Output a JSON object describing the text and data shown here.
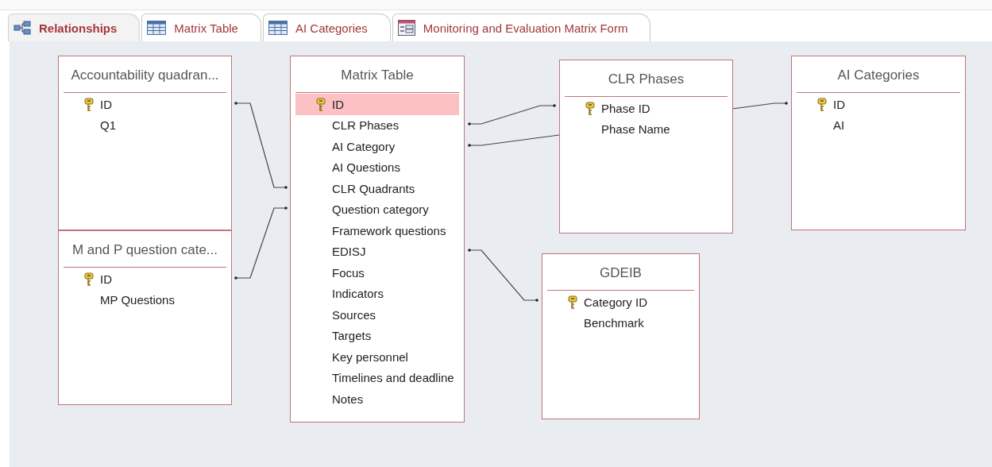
{
  "tabs": [
    {
      "label": "Relationships",
      "selected": true,
      "kind": "relationships"
    },
    {
      "label": "Matrix Table",
      "selected": false,
      "kind": "table"
    },
    {
      "label": "AI Categories",
      "selected": false,
      "kind": "table"
    },
    {
      "label": "Monitoring and Evaluation Matrix Form",
      "selected": false,
      "kind": "form"
    }
  ],
  "tables": [
    {
      "title": "Accountability quadran...",
      "fields": [
        {
          "name": "ID",
          "key": true,
          "selected": false
        },
        {
          "name": "Q1",
          "key": false,
          "selected": false
        }
      ]
    },
    {
      "title": "M and P question cate...",
      "fields": [
        {
          "name": "ID",
          "key": true,
          "selected": false
        },
        {
          "name": "MP Questions",
          "key": false,
          "selected": false
        }
      ]
    },
    {
      "title": "Matrix Table",
      "fields": [
        {
          "name": "ID",
          "key": true,
          "selected": true
        },
        {
          "name": "CLR Phases",
          "key": false,
          "selected": false
        },
        {
          "name": "AI Category",
          "key": false,
          "selected": false
        },
        {
          "name": "AI Questions",
          "key": false,
          "selected": false
        },
        {
          "name": "CLR Quadrants",
          "key": false,
          "selected": false
        },
        {
          "name": "Question category",
          "key": false,
          "selected": false
        },
        {
          "name": "Framework questions",
          "key": false,
          "selected": false
        },
        {
          "name": "EDISJ",
          "key": false,
          "selected": false
        },
        {
          "name": "Focus",
          "key": false,
          "selected": false
        },
        {
          "name": "Indicators",
          "key": false,
          "selected": false
        },
        {
          "name": "Sources",
          "key": false,
          "selected": false
        },
        {
          "name": "Targets",
          "key": false,
          "selected": false
        },
        {
          "name": "Key personnel",
          "key": false,
          "selected": false
        },
        {
          "name": "Timelines and deadline",
          "key": false,
          "selected": false
        },
        {
          "name": "Notes",
          "key": false,
          "selected": false
        }
      ]
    },
    {
      "title": "CLR Phases",
      "fields": [
        {
          "name": "Phase ID",
          "key": true,
          "selected": false
        },
        {
          "name": "Phase Name",
          "key": false,
          "selected": false
        }
      ]
    },
    {
      "title": "AI Categories",
      "fields": [
        {
          "name": "ID",
          "key": true,
          "selected": false
        },
        {
          "name": "AI",
          "key": false,
          "selected": false
        }
      ]
    },
    {
      "title": "GDEIB",
      "fields": [
        {
          "name": "Category ID",
          "key": true,
          "selected": false
        },
        {
          "name": "Benchmark",
          "key": false,
          "selected": false
        }
      ]
    }
  ],
  "relationships": [
    {
      "kind": "join"
    },
    {
      "kind": "join"
    },
    {
      "kind": "join"
    },
    {
      "kind": "join"
    },
    {
      "kind": "join"
    }
  ]
}
